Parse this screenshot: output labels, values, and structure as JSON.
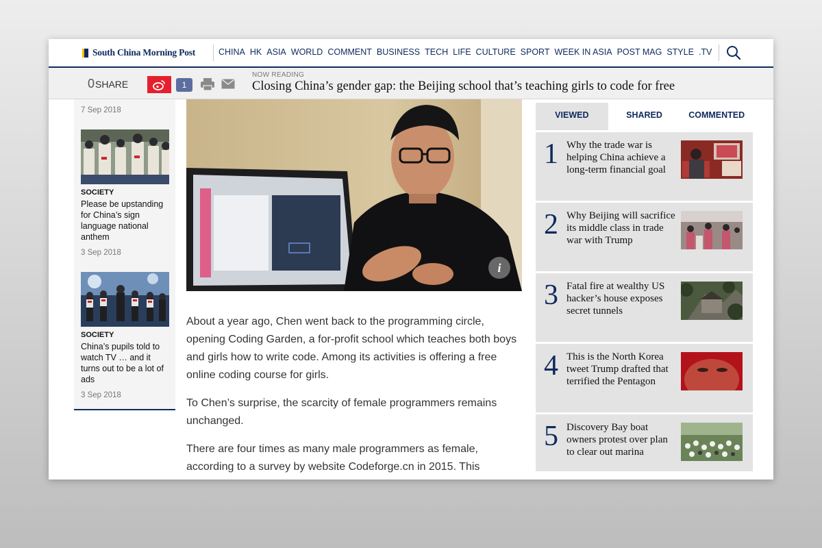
{
  "brand": {
    "name": "South China Morning Post"
  },
  "nav": {
    "items": [
      "CHINA",
      "HK",
      "ASIA",
      "WORLD",
      "COMMENT",
      "BUSINESS",
      "TECH",
      "LIFE",
      "CULTURE",
      "SPORT",
      "WEEK IN ASIA",
      "POST MAG",
      "STYLE",
      ".TV"
    ]
  },
  "readbar": {
    "share_count": "0",
    "share_label": "SHARE",
    "comment_count": "1",
    "now_reading_label": "NOW READING",
    "title": "Closing China’s gender gap: the Beijing school that’s teaching girls to code for free"
  },
  "left": {
    "top_date": "7 Sep 2018",
    "stories": [
      {
        "tag": "SOCIETY",
        "title": "Please be upstanding for China’s sign language national anthem",
        "date": "3 Sep 2018"
      },
      {
        "tag": "SOCIETY",
        "title": "China’s pupils told to watch TV … and it turns out to be a lot of ads",
        "date": "3 Sep 2018"
      }
    ]
  },
  "article": {
    "paragraphs": [
      "About a year ago, Chen went back to the programming circle, opening Coding Garden, a for-profit school which teaches both boys and girls how to write code. Among its activities is offering a free online coding course for girls.",
      "To Chen’s surprise, the scarcity of female programmers remains unchanged.",
      "There are four times as many male programmers as female, according to a survey by website Codeforge.cn in 2015. This"
    ],
    "info_glyph": "i"
  },
  "sidebar": {
    "tabs": [
      "VIEWED",
      "SHARED",
      "COMMENTED"
    ],
    "items": [
      {
        "rank": "1",
        "title": "Why the trade war is helping China achieve a long-term financial goal"
      },
      {
        "rank": "2",
        "title": "Why Beijing will sacrifice its middle class in trade war with Trump"
      },
      {
        "rank": "3",
        "title": "Fatal fire at wealthy US hacker’s house exposes secret tunnels"
      },
      {
        "rank": "4",
        "title": "This is the North Korea tweet Trump drafted that terrified the Pentagon"
      },
      {
        "rank": "5",
        "title": "Discovery Bay boat owners protest over plan to clear out marina"
      }
    ]
  },
  "colors": {
    "brand_navy": "#0f2a5c",
    "brand_yellow": "#f2c200",
    "weibo_red": "#e5202e",
    "badge_blue": "#5b6e9d"
  }
}
